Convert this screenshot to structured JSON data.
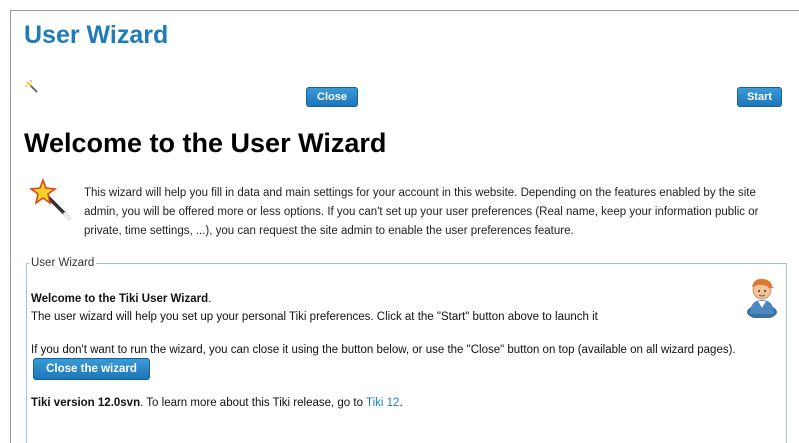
{
  "wizard_title": "User Wizard",
  "buttons": {
    "close": "Close",
    "start": "Start"
  },
  "heading": "Welcome to the User Wizard",
  "intro_text": "This wizard will help you fill in data and main settings for your account in this website. Depending on the features enabled by the site admin, you will be offered more or less options. If you can't set up your user preferences (Real name, keep your information public or private, time settings, ...), you can request the site admin to enable the user preferences feature.",
  "section": {
    "legend": "User Wizard",
    "welcome_bold": "Welcome to the Tiki User Wizard",
    "welcome_period": ".",
    "setup_text": "The user wizard will help you set up your personal Tiki preferences. Click at the \"Start\" button above to launch it",
    "close_hint": "If you don't want to run the wizard, you can close it using the button below, or use the \"Close\" button on top (available on all wizard pages).",
    "close_wizard_button": "Close the wizard",
    "version_bold": "Tiki version 12.0svn",
    "version_text": ". To learn more about this Tiki release, go to ",
    "version_link": "Tiki 12",
    "version_end": "."
  },
  "icons": {
    "wand_small": "magic-wand-icon",
    "wand_large": "magic-wand-icon",
    "avatar": "user-avatar-icon"
  },
  "colors": {
    "title": "#1f7cb8",
    "button": "#2a88c8",
    "link": "#1f7cb8",
    "fieldset_border": "#9ec3df"
  }
}
